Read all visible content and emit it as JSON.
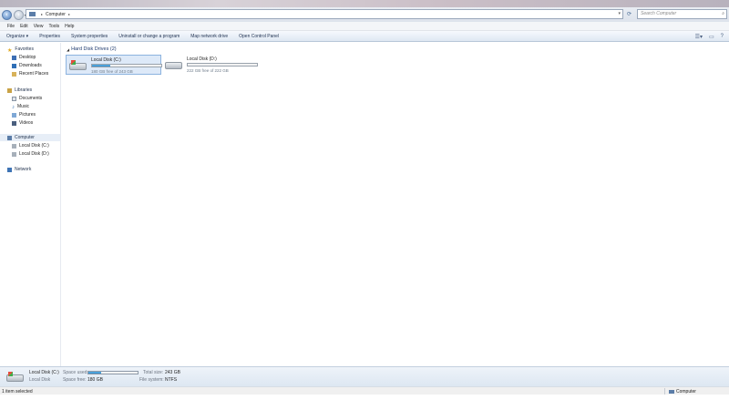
{
  "address": {
    "crumb": "Computer",
    "search_placeholder": "Search Computer"
  },
  "menu": [
    "File",
    "Edit",
    "View",
    "Tools",
    "Help"
  ],
  "toolbar": {
    "commands": [
      "Organize ▾",
      "Properties",
      "System properties",
      "Uninstall or change a program",
      "Map network drive",
      "Open Control Panel"
    ]
  },
  "sidebar": {
    "favorites": {
      "label": "Favorites",
      "items": [
        "Desktop",
        "Downloads",
        "Recent Places"
      ]
    },
    "libraries": {
      "label": "Libraries",
      "items": [
        "Documents",
        "Music",
        "Pictures",
        "Videos"
      ]
    },
    "computer": {
      "label": "Computer",
      "items": [
        "Local Disk (C:)",
        "Local Disk (D:)"
      ]
    },
    "network": {
      "label": "Network"
    }
  },
  "content": {
    "group_label": "Hard Disk Drives (2)",
    "drives": [
      {
        "name": "Local Disk (C:)",
        "free_text": "180 GB free of 243 GB",
        "used_fraction": 0.26,
        "selected": true
      },
      {
        "name": "Local Disk (D:)",
        "free_text": "222 GB free of 222 GB",
        "used_fraction": 0.0,
        "selected": false
      }
    ]
  },
  "details": {
    "name": "Local Disk (C:)",
    "type": "Local Disk",
    "space_used_label": "Space used:",
    "space_used_fraction": 0.26,
    "space_free_label": "Space free:",
    "space_free_value": "180 GB",
    "total_size_label": "Total size:",
    "total_size_value": "243 GB",
    "file_system_label": "File system:",
    "file_system_value": "NTFS"
  },
  "status": {
    "left": "1 item selected",
    "right": "Computer"
  },
  "colors": {
    "accent": "#2a86c9",
    "selection": "#dde9f8"
  }
}
